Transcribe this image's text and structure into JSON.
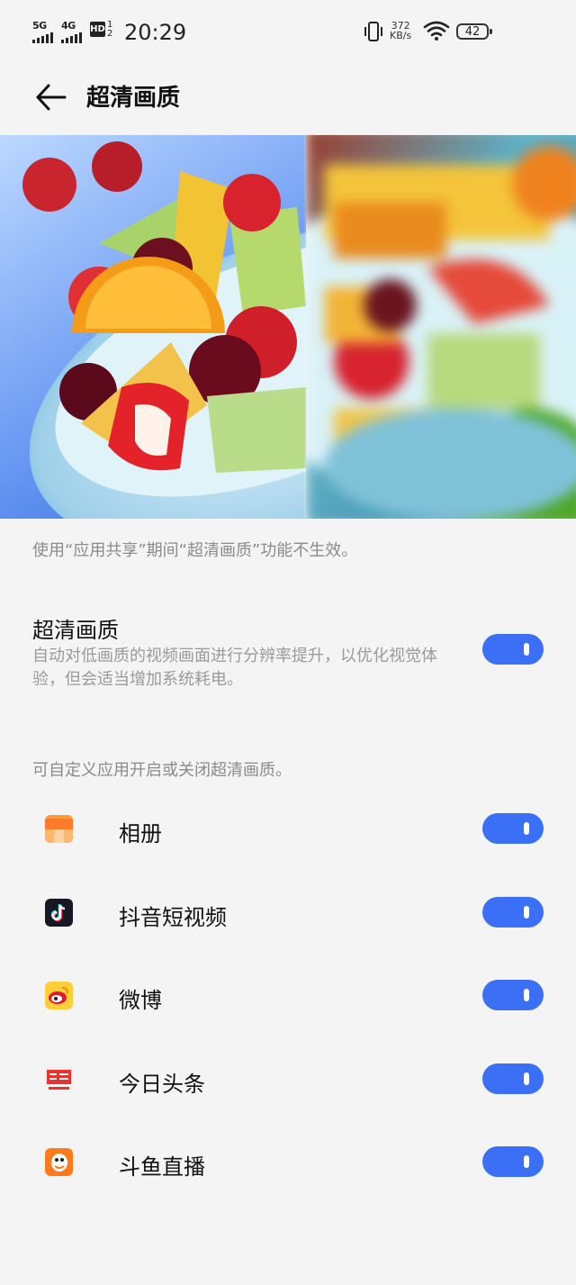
{
  "status_bar": {
    "sim1_label": "5G",
    "sim2_label": "4G",
    "hd_label": "HD",
    "hd_sim_numbers": [
      "1",
      "2"
    ],
    "time": "20:29",
    "net_speed_value": "372",
    "net_speed_unit": "KB/s",
    "battery": "42",
    "icons": [
      "signal-icon",
      "signal-icon",
      "hd-voice-icon",
      "vibrate-icon",
      "wifi-icon",
      "battery-icon"
    ]
  },
  "header": {
    "title": "超清画质",
    "back_icon": "back-arrow-icon"
  },
  "preview": {
    "description": "fruit bowl comparison image",
    "colors": {
      "accent": "#3b6ff5"
    }
  },
  "notice": "使用“应用共享”期间“超清画质”功能不生效。",
  "main_setting": {
    "title": "超清画质",
    "description": "自动对低画质的视频画面进行分辨率提升，以优化视觉体验，但会适当增加系统耗电。",
    "enabled": true
  },
  "apps_section_note": "可自定义应用开启或关闭超清画质。",
  "apps": [
    {
      "name": "相册",
      "icon": "gallery-icon",
      "enabled": true
    },
    {
      "name": "抖音短视频",
      "icon": "douyin-icon",
      "enabled": true
    },
    {
      "name": "微博",
      "icon": "weibo-icon",
      "enabled": true
    },
    {
      "name": "今日头条",
      "icon": "toutiao-icon",
      "enabled": true
    },
    {
      "name": "斗鱼直播",
      "icon": "douyu-icon",
      "enabled": true
    }
  ]
}
